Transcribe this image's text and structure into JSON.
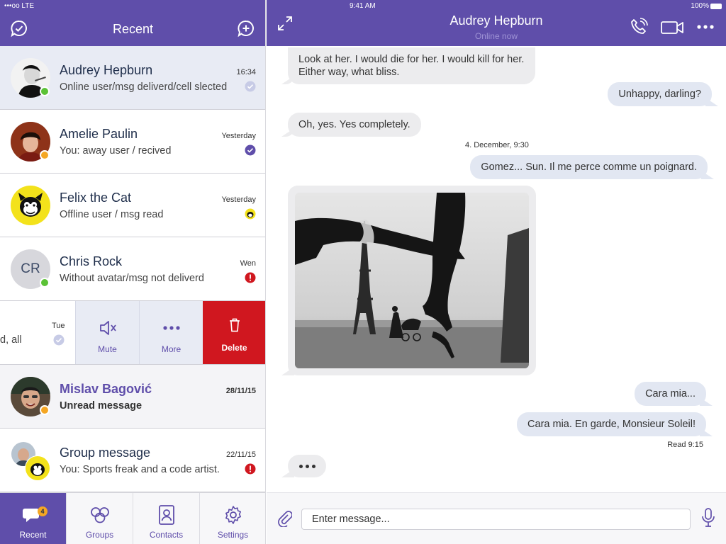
{
  "status_bar": {
    "left": "•••oo LTE",
    "center": "9:41 AM",
    "right": "100%"
  },
  "left_header": {
    "title": "Recent"
  },
  "chats": [
    {
      "name": "Audrey Hepburn",
      "preview": "Online user/msg deliverd/cell slected",
      "time": "16:34",
      "presence": "online",
      "msg_status": "delivered"
    },
    {
      "name": "Amelie Paulin",
      "preview": "You: away user / recived",
      "time": "Yesterday",
      "presence": "away",
      "msg_status": "received"
    },
    {
      "name": "Felix the Cat",
      "preview": "Offline user / msg read",
      "time": "Yesterday",
      "presence": "offline",
      "msg_status": "read"
    },
    {
      "name": "Chris Rock",
      "initials": "CR",
      "preview": "Without avatar/msg not deliverd",
      "time": "Wen",
      "presence": "online",
      "msg_status": "not-delivered"
    }
  ],
  "swiped_chat": {
    "preview_fragment": "d, all",
    "time": "Tue",
    "msg_status": "delivered"
  },
  "swipe_actions": {
    "mute": "Mute",
    "more": "More",
    "delete": "Delete"
  },
  "chats_after": [
    {
      "name": "Mislav Bagović",
      "preview": "Unread message",
      "time": "28/11/15",
      "presence": "away",
      "unread": true
    },
    {
      "name": "Group message",
      "preview": "You: Sports freak and a code artist.",
      "time": "22/11/15",
      "msg_status": "not-delivered"
    }
  ],
  "tabs": [
    {
      "label": "Recent",
      "active": true,
      "badge": "4"
    },
    {
      "label": "Groups"
    },
    {
      "label": "Contacts"
    },
    {
      "label": "Settings"
    }
  ],
  "conversation": {
    "contact_name": "Audrey Hepburn",
    "contact_status": "Online now",
    "messages": [
      {
        "dir": "in",
        "text": "Look at her. I would die for her. I would kill for her. Either way, what bliss."
      },
      {
        "dir": "out",
        "text": "Unhappy, darling?"
      },
      {
        "dir": "in",
        "text": "Oh, yes. Yes completely."
      },
      {
        "dir": "out",
        "text": "Gomez... Sun. Il me perce comme un poignard."
      },
      {
        "dir": "out",
        "text": "Cara mia..."
      },
      {
        "dir": "out",
        "text": "Cara mia. En garde, Monsieur Soleil!"
      }
    ],
    "date_separator": "4. December, 9:30",
    "read_receipt": "Read 9:15"
  },
  "composer": {
    "placeholder": "Enter message..."
  },
  "colors": {
    "primary": "#5f4eaa",
    "online": "#5bc236",
    "away": "#f5a623",
    "error": "#d0171f",
    "delete": "#d0171f"
  }
}
